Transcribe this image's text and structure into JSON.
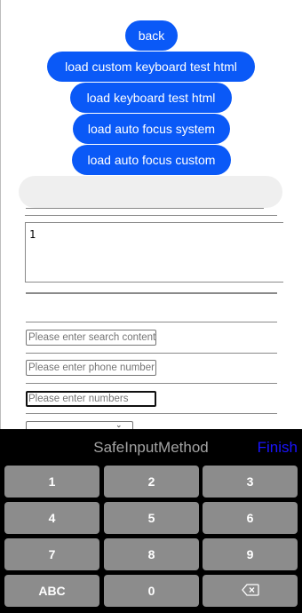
{
  "buttons": {
    "back": "back",
    "load_custom_keyboard": "load custom keyboard test html",
    "load_keyboard": "load keyboard test html",
    "load_auto_focus_system": "load auto focus system",
    "load_auto_focus_custom": "load auto focus custom"
  },
  "textarea": {
    "value": "1"
  },
  "inputs": {
    "search_placeholder": "Please enter search content",
    "phone_placeholder": "Please enter phone number",
    "numbers_placeholder": "Please enter numbers"
  },
  "keyboard": {
    "title": "SafeInputMethod",
    "finish": "Finish",
    "keys": {
      "k1": "1",
      "k2": "2",
      "k3": "3",
      "k4": "4",
      "k5": "5",
      "k6": "6",
      "k7": "7",
      "k8": "8",
      "k9": "9",
      "abc": "ABC",
      "k0": "0",
      "backspace_icon": "backspace-icon"
    }
  },
  "colors": {
    "accent": "#0a59f7",
    "finish": "#1a14ff",
    "key": "#8c8c8c",
    "keyboard_bg": "#000000"
  }
}
